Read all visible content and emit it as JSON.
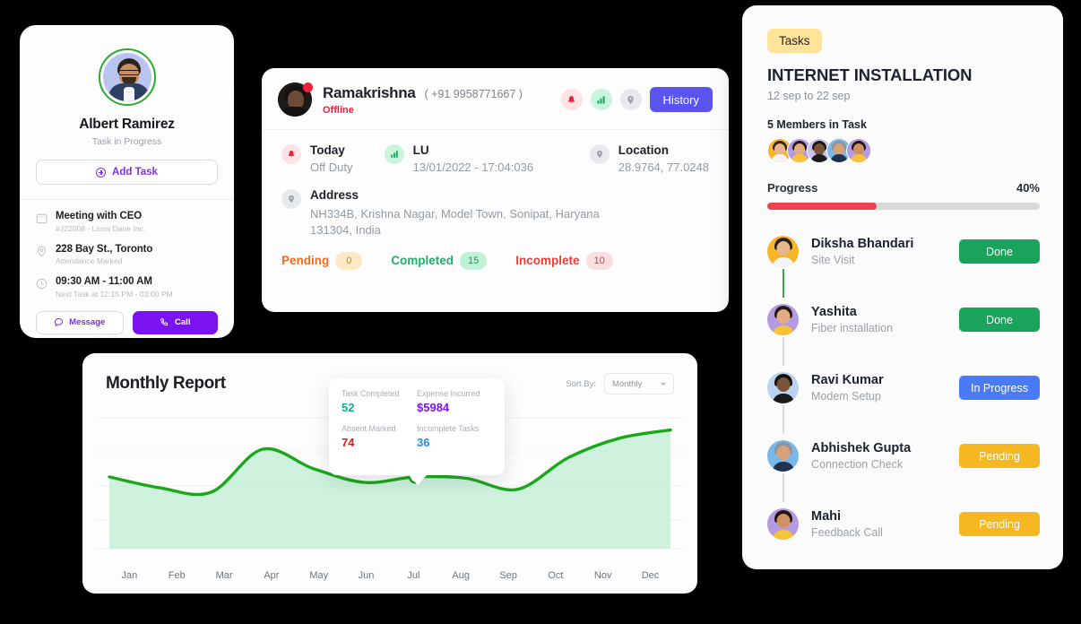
{
  "profile_card": {
    "avatar": "user-photo",
    "name": "Albert Ramirez",
    "status": "Task in Progress",
    "add_task_label": "Add Task",
    "info_rows": [
      {
        "icon": "calendar-icon",
        "title": "Meeting with CEO",
        "sub": "#J22008 - Lions Dane Inc."
      },
      {
        "icon": "location-pin-icon",
        "title": "228 Bay St., Toronto",
        "sub": "Attendance Marked"
      },
      {
        "icon": "clock-icon",
        "title": "09:30 AM - 11:00 AM",
        "sub": "Next Task at 12:15 PM - 03:00 PM"
      }
    ],
    "message_label": "Message",
    "call_label": "Call"
  },
  "agent_card": {
    "name": "Ramakrishna",
    "phone": "( +91 9958771667 )",
    "status": "Offline",
    "history_label": "History",
    "header_icons": [
      "bell-icon",
      "bar-chart-icon",
      "location-pin-icon"
    ],
    "stats": [
      {
        "icon": "bell-icon",
        "label": "Today",
        "value": "Off Duty"
      },
      {
        "icon": "bar-chart-icon",
        "label": "LU",
        "value": "13/01/2022 - 17:04:036"
      },
      {
        "icon": "location-pin-icon",
        "label": "Location",
        "value": "28.9764, 77.0248"
      }
    ],
    "address": {
      "icon": "location-pin-icon",
      "title": "Address",
      "text": "NH334B, Krishna Nagar, Model Town, Sonipat, Haryana 131304, India"
    },
    "chips": [
      {
        "label": "Pending",
        "count": "0"
      },
      {
        "label": "Completed",
        "count": "15"
      },
      {
        "label": "Incomplete",
        "count": "10"
      }
    ]
  },
  "chart_card": {
    "title": "Monthly Report",
    "sort_label": "Sort By:",
    "sort_value": "Monthly",
    "tooltip": [
      {
        "label": "Task Completed",
        "value": "52",
        "color": "#00b894"
      },
      {
        "label": "Expense Incurred",
        "value": "$5984",
        "color": "#7b13f0"
      },
      {
        "label": "Absent Marked",
        "value": "74",
        "color": "#f31212"
      },
      {
        "label": "Incomplete Tasks",
        "value": "36",
        "color": "#1f8ef1"
      }
    ]
  },
  "chart_data": {
    "type": "area",
    "title": "Monthly Report",
    "xlabel": "",
    "ylabel": "",
    "categories": [
      "Jan",
      "Feb",
      "Mar",
      "Apr",
      "May",
      "Jun",
      "Jul",
      "Aug",
      "Sep",
      "Oct",
      "Nov",
      "Dec"
    ],
    "values": [
      52,
      44,
      41,
      72,
      58,
      48,
      52,
      51,
      43,
      66,
      80,
      86
    ],
    "ylim": [
      0,
      100
    ],
    "grid": true,
    "legend": "none",
    "line_color": "#1aa81a",
    "fill_color": "#bdedd1",
    "highlight_point": {
      "category": "Jul",
      "value": 52
    }
  },
  "tasks_panel": {
    "badge": "Tasks",
    "title": "INTERNET INSTALLATION",
    "dates": "12 sep to 22 sep",
    "members_label": "5 Members in Task",
    "member_avatars": [
      {
        "bg": "#f7b52a",
        "hair": "#2c211a",
        "skin": "#e8b68c",
        "body": "#f2f4f7"
      },
      {
        "bg": "#b49ae0",
        "hair": "#241a14",
        "skin": "#e5ac83",
        "body": "#f5c23a"
      },
      {
        "bg": "#c9c2ef",
        "hair": "#1a120d",
        "skin": "#7a5338",
        "body": "#1b1b1b"
      },
      {
        "bg": "#7ab8ea",
        "hair": "#8e9399",
        "skin": "#d9a276",
        "body": "#1f3350"
      },
      {
        "bg": "#b49ae0",
        "hair": "#231712",
        "skin": "#cf9162",
        "body": "#f5c23a"
      }
    ],
    "progress_label": "Progress",
    "progress_pct": "40%",
    "progress_value": 40,
    "progress_color": "#ef4250",
    "items": [
      {
        "name": "Diksha Bhandari",
        "role": "Site Visit",
        "badge": "Done",
        "badge_color": "#1aa35a",
        "avatar": {
          "bg": "#f7b52a",
          "hair": "#2c211a",
          "skin": "#e8b68c",
          "body": "#f2f4f7"
        },
        "connector": "#35a853"
      },
      {
        "name": "Yashita",
        "role": "Fiber installation",
        "badge": "Done",
        "badge_color": "#1aa35a",
        "avatar": {
          "bg": "#b49ae0",
          "hair": "#241a14",
          "skin": "#e5ac83",
          "body": "#f5c23a"
        },
        "connector": "#d9dbde"
      },
      {
        "name": "Ravi Kumar",
        "role": "Modem Setup",
        "badge": "In Progress",
        "badge_color": "#4a7bf7",
        "avatar": {
          "bg": "#b9d4f2",
          "hair": "#1a120d",
          "skin": "#7a5338",
          "body": "#1b1b1b"
        },
        "connector": "#d9dbde"
      },
      {
        "name": "Abhishek Gupta",
        "role": "Connection Check",
        "badge": "Pending",
        "badge_color": "#f5b722",
        "avatar": {
          "bg": "#7ab8ea",
          "hair": "#8e9399",
          "skin": "#d9a276",
          "body": "#1f3350"
        },
        "connector": "#d9dbde"
      },
      {
        "name": "Mahi",
        "role": "Feedback Call",
        "badge": "Pending",
        "badge_color": "#f5b722",
        "avatar": {
          "bg": "#b49ae0",
          "hair": "#231712",
          "skin": "#cf9162",
          "body": "#f5c23a"
        },
        "connector": ""
      }
    ]
  }
}
